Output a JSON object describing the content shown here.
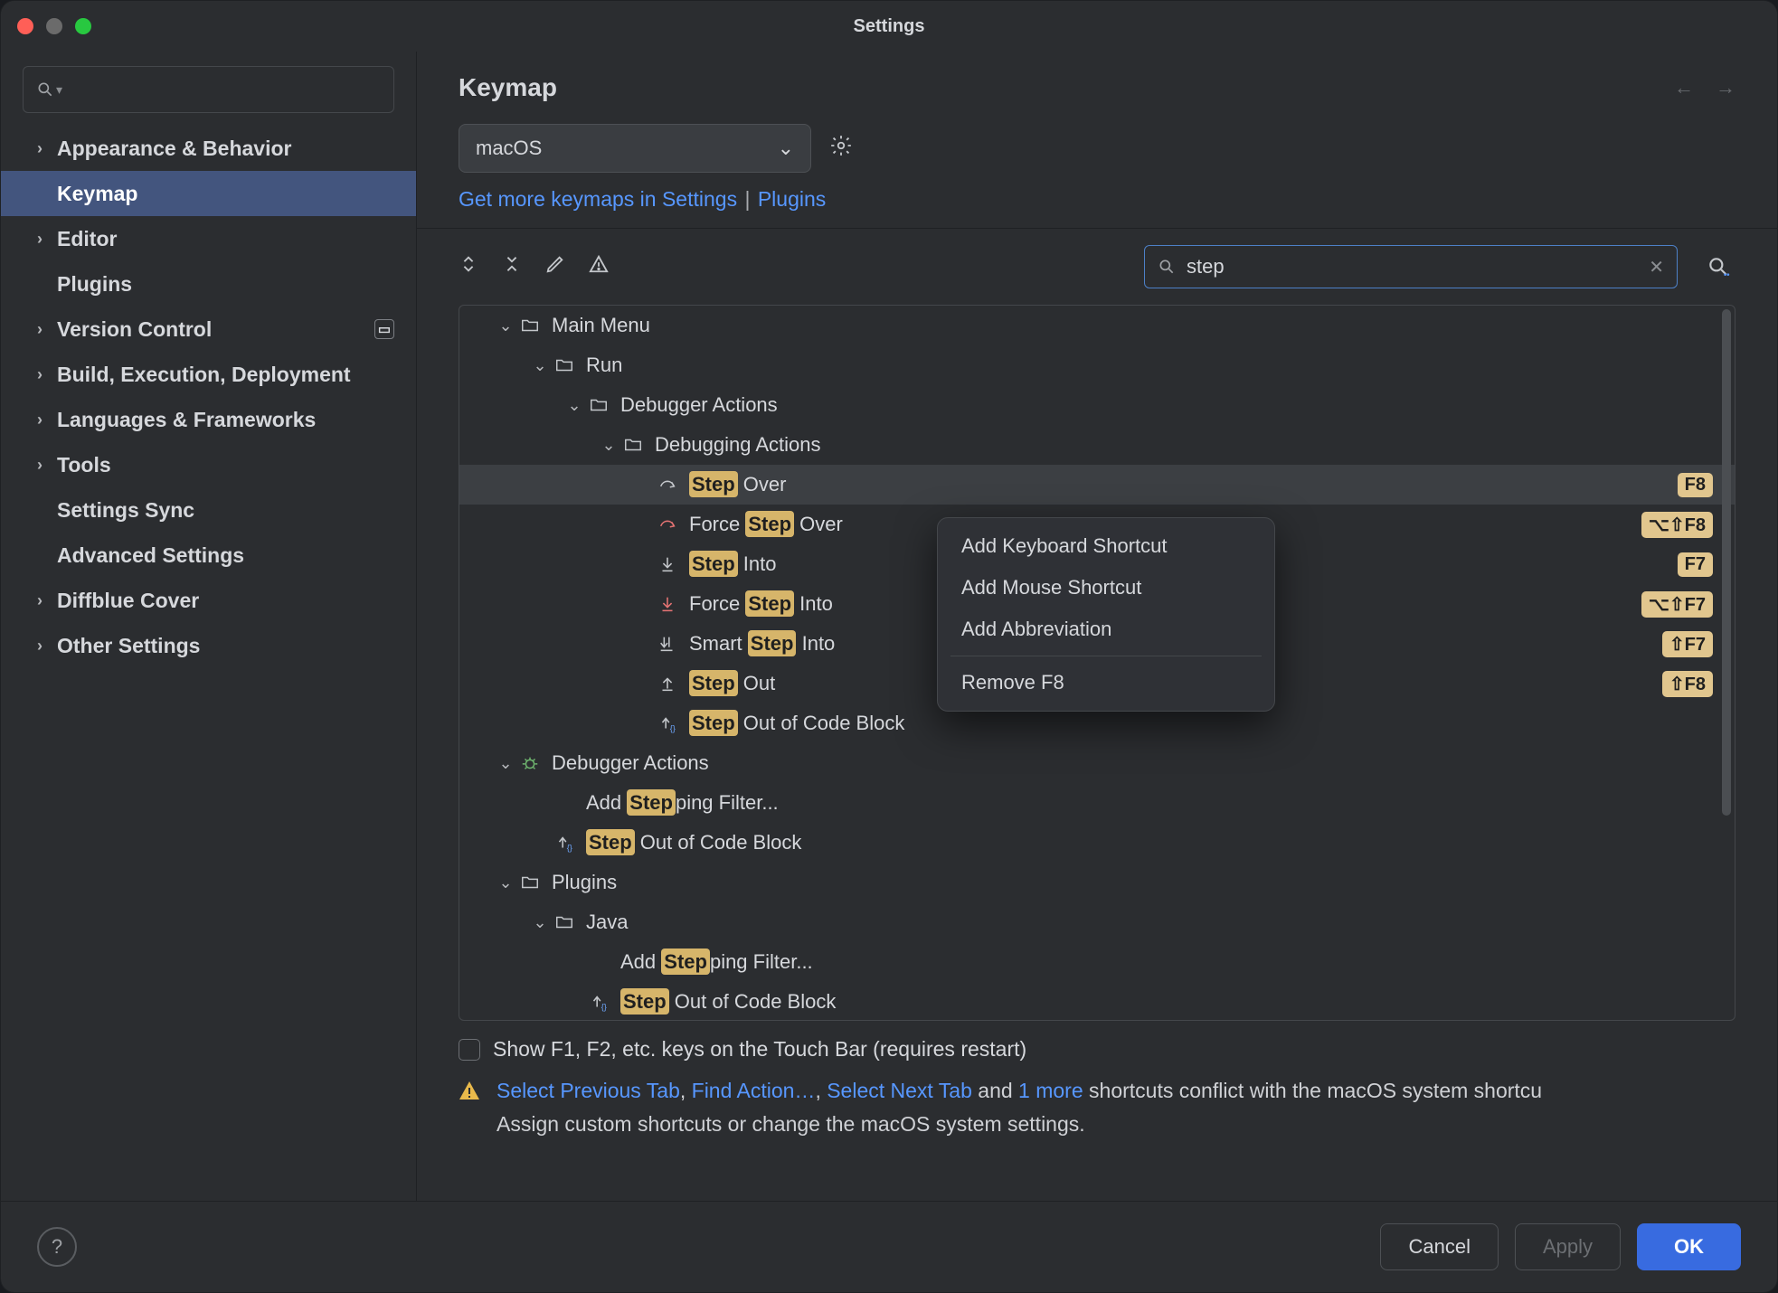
{
  "window": {
    "title": "Settings"
  },
  "sidebar": {
    "search_placeholder": "",
    "items": [
      {
        "label": "Appearance & Behavior",
        "expandable": true,
        "bold": true
      },
      {
        "label": "Keymap",
        "expandable": false,
        "bold": true,
        "selected": true
      },
      {
        "label": "Editor",
        "expandable": true,
        "bold": true
      },
      {
        "label": "Plugins",
        "expandable": false,
        "bold": true
      },
      {
        "label": "Version Control",
        "expandable": true,
        "bold": true,
        "badge": true
      },
      {
        "label": "Build, Execution, Deployment",
        "expandable": true,
        "bold": true
      },
      {
        "label": "Languages & Frameworks",
        "expandable": true,
        "bold": true
      },
      {
        "label": "Tools",
        "expandable": true,
        "bold": true
      },
      {
        "label": "Settings Sync",
        "expandable": false,
        "bold": true
      },
      {
        "label": "Advanced Settings",
        "expandable": false,
        "bold": true
      },
      {
        "label": "Diffblue Cover",
        "expandable": true,
        "bold": true
      },
      {
        "label": "Other Settings",
        "expandable": true,
        "bold": true
      }
    ]
  },
  "page": {
    "title": "Keymap"
  },
  "keymap_select": {
    "value": "macOS"
  },
  "get_more": {
    "first": "Get more keymaps in Settings",
    "sep": "|",
    "second": "Plugins"
  },
  "tool_search": {
    "value": "step"
  },
  "tree": {
    "n0": {
      "label": "Main Menu"
    },
    "n1": {
      "label": "Run"
    },
    "n2": {
      "label": "Debugger Actions"
    },
    "n3": {
      "label": "Debugging Actions"
    },
    "leaves": [
      {
        "pre": "",
        "hl": "Step",
        "post": " Over",
        "shortcut": "F8",
        "icon": "step-over",
        "selected": true
      },
      {
        "pre": "Force ",
        "hl": "Step",
        "post": " Over",
        "shortcut": "⌥⇧F8",
        "icon": "force-step-over"
      },
      {
        "pre": "",
        "hl": "Step",
        "post": " Into",
        "shortcut": "F7",
        "icon": "step-into"
      },
      {
        "pre": "Force ",
        "hl": "Step",
        "post": " Into",
        "shortcut": "⌥⇧F7",
        "icon": "force-step-into"
      },
      {
        "pre": "Smart ",
        "hl": "Step",
        "post": " Into",
        "shortcut": "⇧F7",
        "icon": "smart-step-into"
      },
      {
        "pre": "",
        "hl": "Step",
        "post": " Out",
        "shortcut": "⇧F8",
        "icon": "step-out"
      },
      {
        "pre": "",
        "hl": "Step",
        "post": " Out of Code Block",
        "shortcut": "",
        "icon": "step-out-block"
      }
    ],
    "dbg2": {
      "label": "Debugger Actions"
    },
    "dbg2_items": [
      {
        "pre": "Add ",
        "hl": "Step",
        "post": "ping Filter...",
        "icon": ""
      },
      {
        "pre": "",
        "hl": "Step",
        "post": " Out of Code Block",
        "icon": "step-out-block"
      }
    ],
    "plugins": {
      "label": "Plugins"
    },
    "java": {
      "label": "Java"
    },
    "java_items": [
      {
        "pre": "Add ",
        "hl": "Step",
        "post": "ping Filter...",
        "icon": ""
      },
      {
        "pre": "",
        "hl": "Step",
        "post": " Out of Code Block",
        "icon": "step-out-block"
      }
    ]
  },
  "touchbar": {
    "label": "Show F1, F2, etc. keys on the Touch Bar (requires restart)"
  },
  "conflict": {
    "links": [
      "Select Previous Tab",
      "Find Action…",
      "Select Next Tab",
      "1 more"
    ],
    "joins": [
      ", ",
      ", ",
      " and "
    ],
    "tail": " shortcuts conflict with the macOS system shortcu",
    "line2": "Assign custom shortcuts or change the macOS system settings."
  },
  "context_menu": {
    "items": [
      "Add Keyboard Shortcut",
      "Add Mouse Shortcut",
      "Add Abbreviation"
    ],
    "remove": "Remove F8"
  },
  "footer": {
    "cancel": "Cancel",
    "apply": "Apply",
    "ok": "OK"
  }
}
